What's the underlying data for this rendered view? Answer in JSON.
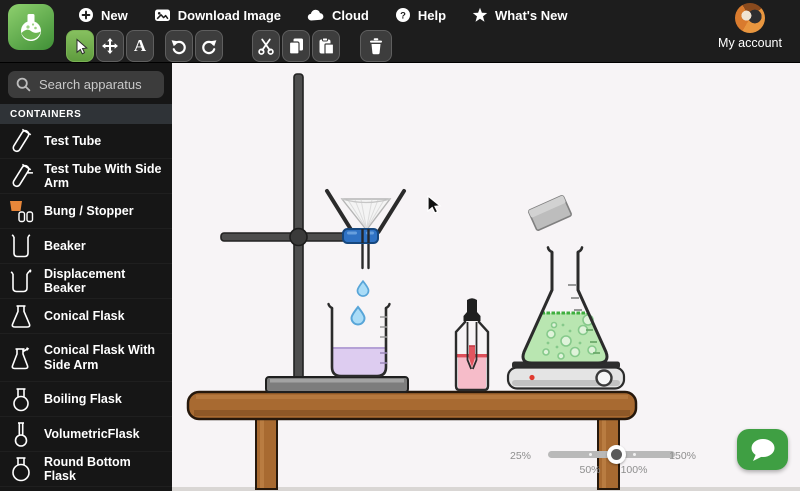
{
  "header": {
    "menu": [
      {
        "label": "New",
        "icon": "plus-circle-icon"
      },
      {
        "label": "Download Image",
        "icon": "image-icon"
      },
      {
        "label": "Cloud",
        "icon": "cloud-icon"
      },
      {
        "label": "Help",
        "icon": "help-circle-icon"
      },
      {
        "label": "What's New",
        "icon": "star-icon"
      }
    ],
    "account": {
      "label": "My account"
    }
  },
  "toolbar": {
    "tools": [
      {
        "name": "select",
        "icon": "cursor-icon",
        "active": true
      },
      {
        "name": "move",
        "icon": "move-icon",
        "active": false
      },
      {
        "name": "text",
        "icon": "text-icon",
        "glyph": "A",
        "active": false
      },
      {
        "name": "undo",
        "icon": "undo-icon"
      },
      {
        "name": "redo",
        "icon": "redo-icon"
      },
      {
        "name": "cut",
        "icon": "scissors-icon"
      },
      {
        "name": "copy",
        "icon": "copy-icon"
      },
      {
        "name": "paste",
        "icon": "paste-icon"
      },
      {
        "name": "delete",
        "icon": "trash-icon"
      }
    ]
  },
  "sidebar": {
    "search_placeholder": "Search apparatus",
    "section_title": "CONTAINERS",
    "items": [
      {
        "label": "Test Tube",
        "icon": "test-tube-icon"
      },
      {
        "label": "Test Tube With Side Arm",
        "icon": "test-tube-side-arm-icon"
      },
      {
        "label": "Bung / Stopper",
        "icon": "bung-stopper-icon"
      },
      {
        "label": "Beaker",
        "icon": "beaker-icon"
      },
      {
        "label": "Displacement Beaker",
        "icon": "displacement-beaker-icon"
      },
      {
        "label": "Conical Flask",
        "icon": "conical-flask-icon"
      },
      {
        "label": "Conical Flask With Side Arm",
        "icon": "conical-flask-side-arm-icon"
      },
      {
        "label": "Boiling Flask",
        "icon": "boiling-flask-icon"
      },
      {
        "label": "VolumetricFlask",
        "icon": "volumetric-flask-icon"
      },
      {
        "label": "Round Bottom Flask",
        "icon": "round-bottom-flask-icon"
      }
    ]
  },
  "canvas": {
    "apparatus": [
      "retort-stand",
      "boss-clamp",
      "filter-funnel-with-paper",
      "water-drops",
      "beaker-with-purple-liquid",
      "dropper-bottle-with-pink-liquid",
      "conical-flask-with-green-boiling-liquid",
      "hot-plate",
      "metal-strip",
      "wooden-table"
    ]
  },
  "zoom_control": {
    "min_label": "25%",
    "marks": [
      {
        "label": "50%"
      },
      {
        "label": "100%"
      }
    ],
    "max_label": "150%"
  },
  "colors": {
    "accent_green": "#67ab4a",
    "chat_green": "#3f9f43",
    "clamp_blue": "#2f72c4",
    "drop_blue": "#aadcf7",
    "drop_border": "#58a5d8",
    "beaker_liquid": "#ddccf0",
    "flask_liquid": "#b9e6b1",
    "flask_surface": "#3fae3f",
    "dropper_liquid": "#f6bcc9",
    "table_brown": "#a86a31",
    "stopper_orange": "#e8873a"
  }
}
